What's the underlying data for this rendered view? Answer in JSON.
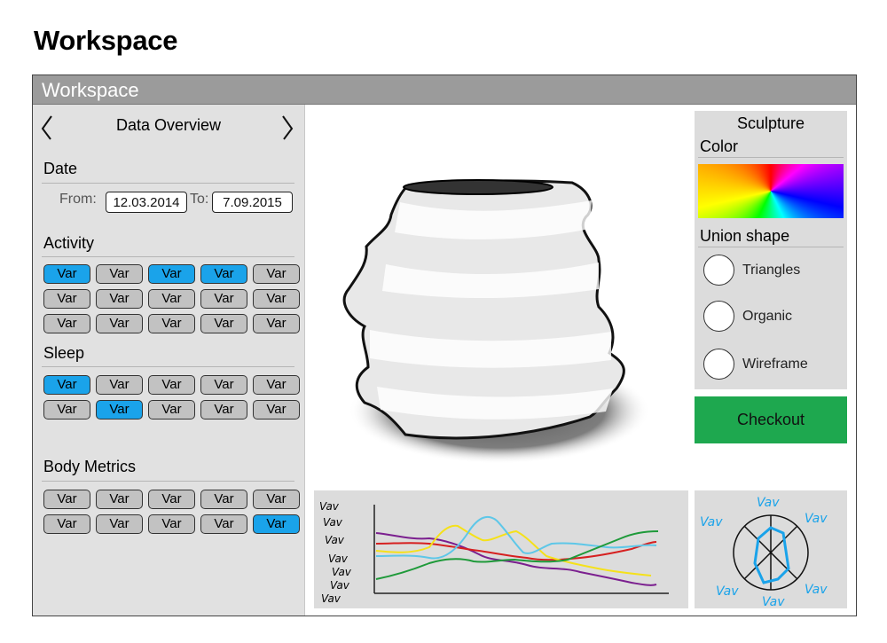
{
  "page": {
    "title": "Workspace"
  },
  "window": {
    "title": "Workspace"
  },
  "left_panel": {
    "header": "Data Overview",
    "date": {
      "label": "Date",
      "from_label": "From:",
      "from_value": "12.03.2014",
      "to_label": "To:",
      "to_value": "7.09.2015"
    },
    "activity": {
      "label": "Activity",
      "buttons": [
        {
          "label": "Var",
          "selected": true
        },
        {
          "label": "Var",
          "selected": false
        },
        {
          "label": "Var",
          "selected": true
        },
        {
          "label": "Var",
          "selected": true
        },
        {
          "label": "Var",
          "selected": false
        },
        {
          "label": "Var",
          "selected": false
        },
        {
          "label": "Var",
          "selected": false
        },
        {
          "label": "Var",
          "selected": false
        },
        {
          "label": "Var",
          "selected": false
        },
        {
          "label": "Var",
          "selected": false
        },
        {
          "label": "Var",
          "selected": false
        },
        {
          "label": "Var",
          "selected": false
        },
        {
          "label": "Var",
          "selected": false
        },
        {
          "label": "Var",
          "selected": false
        },
        {
          "label": "Var",
          "selected": false
        }
      ]
    },
    "sleep": {
      "label": "Sleep",
      "buttons": [
        {
          "label": "Var",
          "selected": true
        },
        {
          "label": "Var",
          "selected": false
        },
        {
          "label": "Var",
          "selected": false
        },
        {
          "label": "Var",
          "selected": false
        },
        {
          "label": "Var",
          "selected": false
        },
        {
          "label": "Var",
          "selected": false
        },
        {
          "label": "Var",
          "selected": true
        },
        {
          "label": "Var",
          "selected": false
        },
        {
          "label": "Var",
          "selected": false
        },
        {
          "label": "Var",
          "selected": false
        }
      ]
    },
    "body_metrics": {
      "label": "Body Metrics",
      "buttons": [
        {
          "label": "Var",
          "selected": false
        },
        {
          "label": "Var",
          "selected": false
        },
        {
          "label": "Var",
          "selected": false
        },
        {
          "label": "Var",
          "selected": false
        },
        {
          "label": "Var",
          "selected": false
        },
        {
          "label": "Var",
          "selected": false
        },
        {
          "label": "Var",
          "selected": false
        },
        {
          "label": "Var",
          "selected": false
        },
        {
          "label": "Var",
          "selected": false
        },
        {
          "label": "Var",
          "selected": true
        }
      ]
    }
  },
  "right_panel": {
    "title": "Sculpture",
    "color_label": "Color",
    "union_label": "Union shape",
    "options": [
      "Triangles",
      "Organic",
      "Wireframe"
    ],
    "checkout_label": "Checkout"
  },
  "chart_data": {
    "type": "line",
    "ylabels": [
      "Vav",
      "Vav",
      "Vav",
      "Vav",
      "Vav",
      "Vav",
      "Vav"
    ],
    "series_colors": [
      "#7b1f8f",
      "#d62020",
      "#f5e11a",
      "#5ec7e8",
      "#1f9a3a"
    ]
  },
  "radar": {
    "labels": [
      "Vav",
      "Vav",
      "Vav",
      "Vav",
      "Vav",
      "Vav"
    ],
    "color": "#1aa3ea"
  },
  "colors": {
    "selected": "#1aa3ea",
    "checkout": "#1ea84f",
    "titlebar": "#9b9b9b"
  }
}
